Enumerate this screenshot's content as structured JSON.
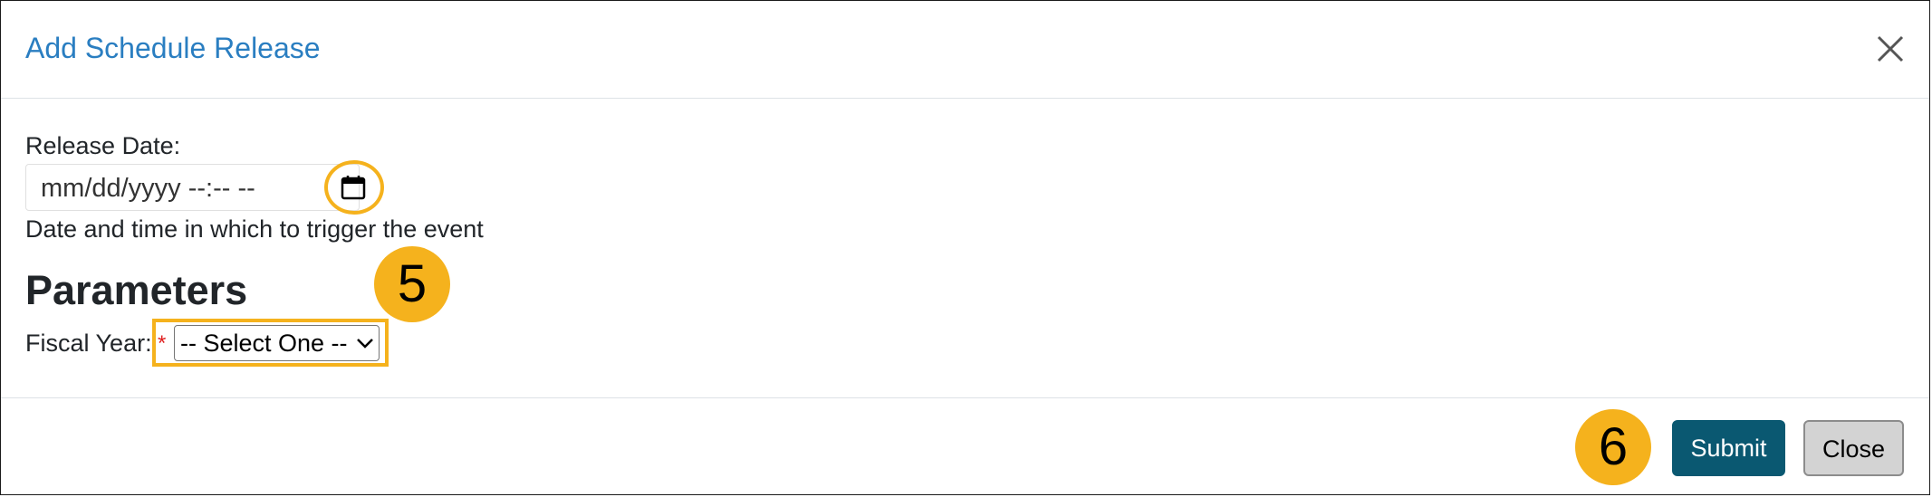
{
  "dialog": {
    "title": "Add Schedule Release",
    "close_icon": "close-icon"
  },
  "form": {
    "release_date": {
      "label": "Release Date:",
      "placeholder": "mm/dd/yyyy --:-- --",
      "value": "",
      "help": "Date and time in which to trigger the event",
      "calendar_icon": "calendar-icon"
    },
    "parameters_heading": "Parameters",
    "fiscal_year": {
      "label": "Fiscal Year:",
      "required_marker": "*",
      "selected": "-- Select One --"
    }
  },
  "footer": {
    "submit_label": "Submit",
    "close_label": "Close"
  },
  "annotations": {
    "step_5": "5",
    "step_6": "6"
  },
  "colors": {
    "title": "#2a7ec1",
    "highlight": "#f5b21d",
    "submit_bg": "#0a5871",
    "close_bg": "#d3d3d3",
    "required": "#e02020"
  }
}
